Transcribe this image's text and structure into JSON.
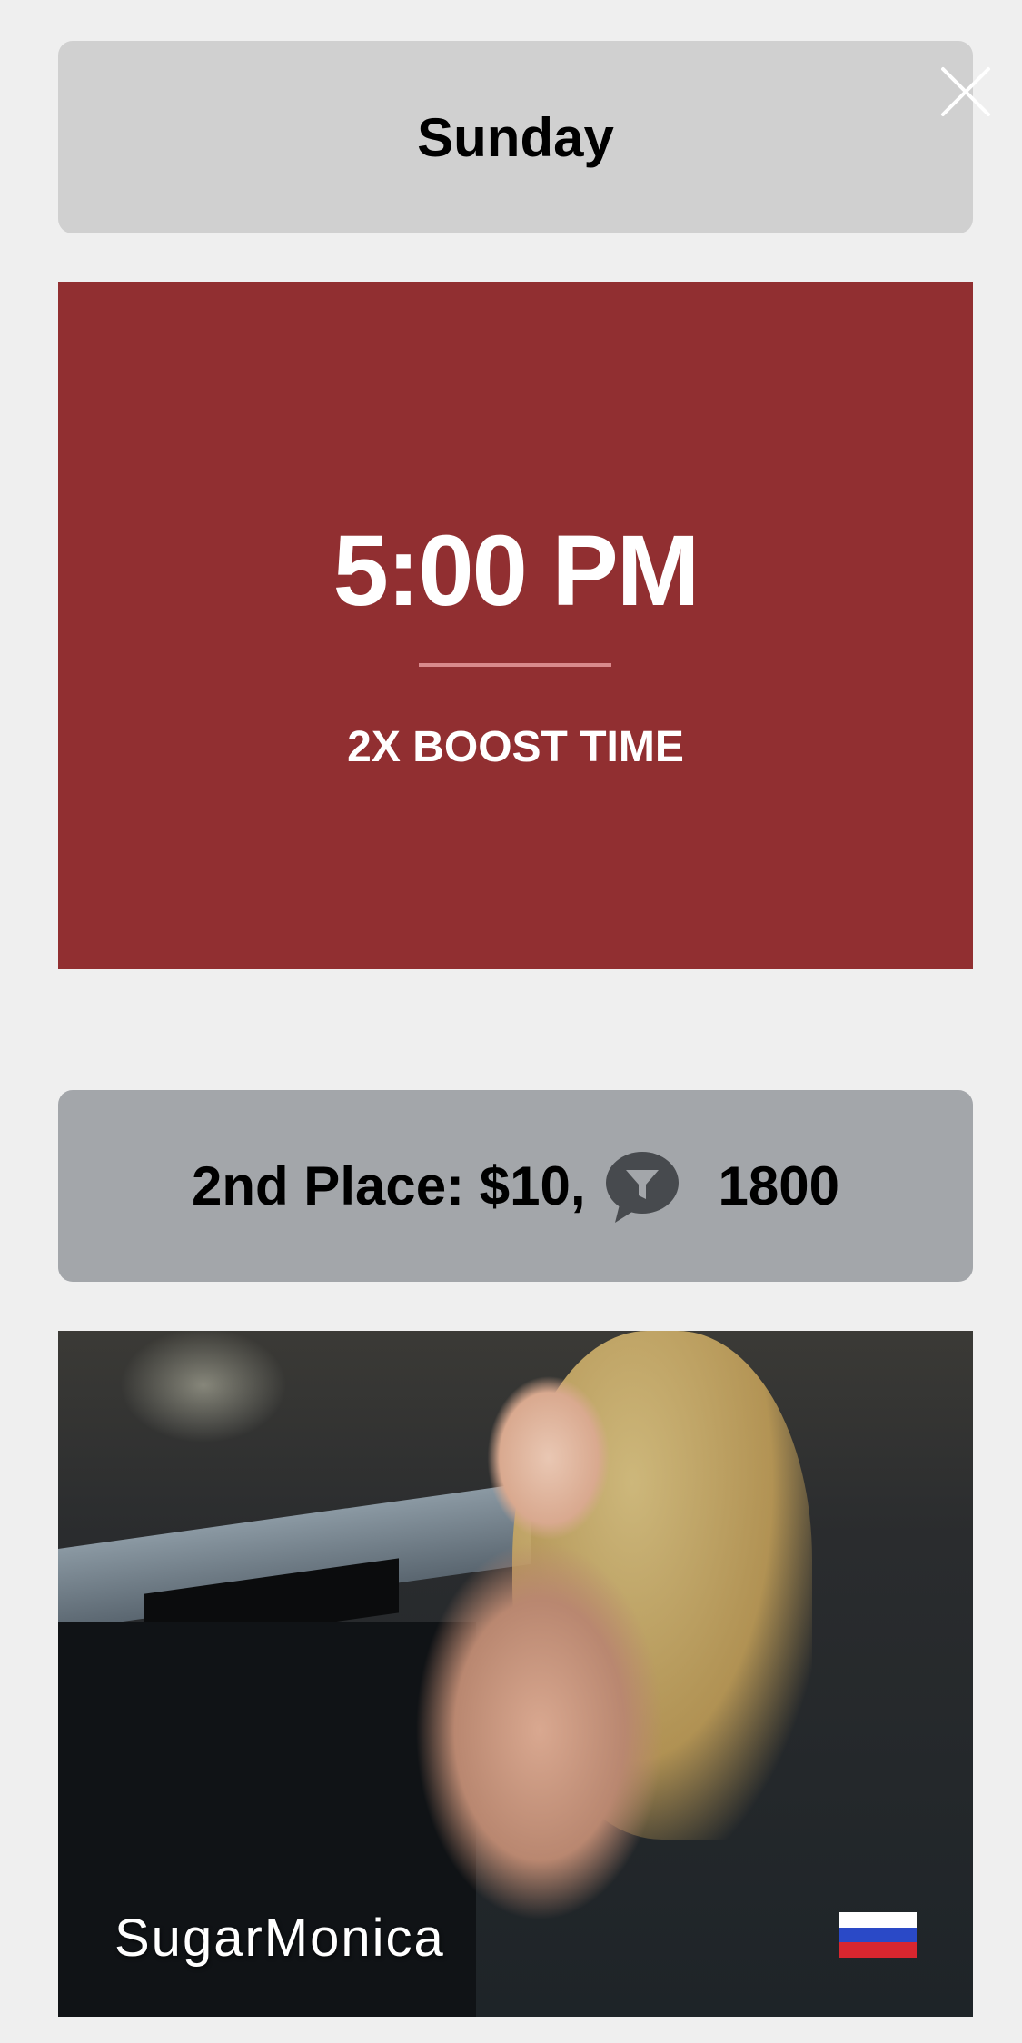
{
  "schedule": {
    "day": "Sunday",
    "close_icon": "close-icon"
  },
  "slot": {
    "time": "5:00 PM",
    "boost_label": "2X BOOST TIME",
    "background_color": "#912f31"
  },
  "prize": {
    "label": "2nd Place: $10,",
    "coin_icon": "token-icon",
    "tokens": "1800"
  },
  "model": {
    "name": "SugarMonica",
    "flag_icon": "russia-flag-icon",
    "flag_colors": [
      "#ffffff",
      "#2a49c7",
      "#d8262f"
    ]
  }
}
